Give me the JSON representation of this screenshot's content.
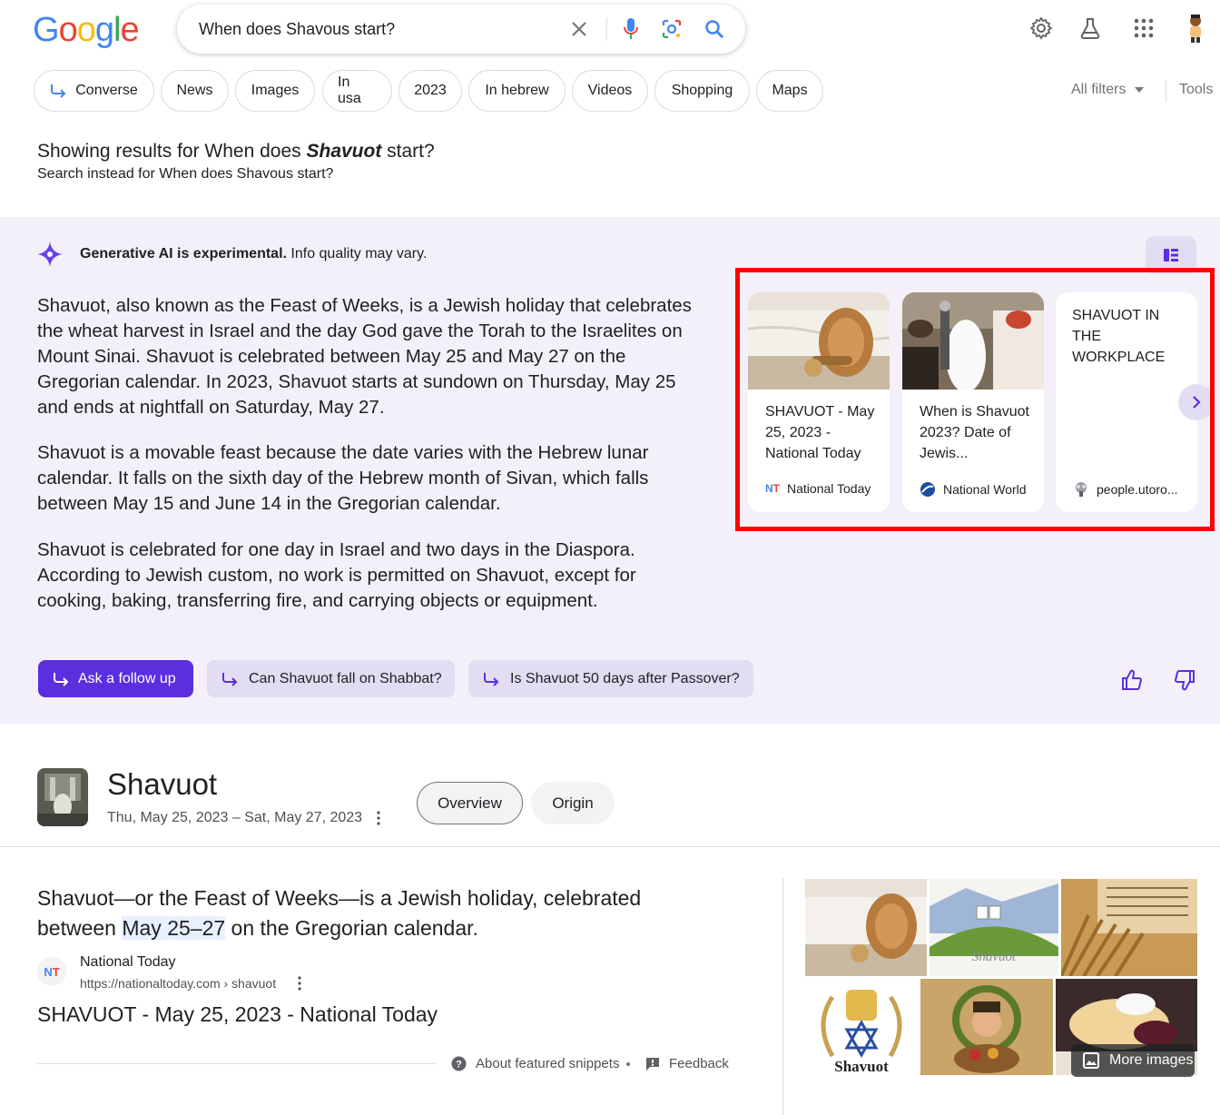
{
  "logo": {
    "letters": [
      "G",
      "o",
      "o",
      "g",
      "l",
      "e"
    ],
    "colors": [
      "#4285f4",
      "#ea4335",
      "#fbbc05",
      "#4285f4",
      "#34a853",
      "#ea4335"
    ]
  },
  "search": {
    "query": "When does Shavous start?"
  },
  "chips": {
    "converse": "Converse",
    "news": "News",
    "images": "Images",
    "in_usa": "In usa",
    "year": "2023",
    "in_hebrew": "In hebrew",
    "videos": "Videos",
    "shopping": "Shopping",
    "maps": "Maps"
  },
  "filters": {
    "all_filters": "All filters",
    "tools": "Tools"
  },
  "correction": {
    "showing_prefix": "Showing results for When does ",
    "showing_bold": "Shavuot",
    "showing_suffix": " start?",
    "instead": "Search instead for When does Shavous start?"
  },
  "ai": {
    "notice_bold": "Generative AI is experimental.",
    "notice_rest": " Info quality may vary.",
    "paragraphs": [
      "Shavuot, also known as the Feast of Weeks, is a Jewish holiday that celebrates the wheat harvest in Israel and the day God gave the Torah to the Israelites on Mount Sinai. Shavuot is celebrated between May 25 and May 27 on the Gregorian calendar. In 2023, Shavuot starts at sundown on Thursday, May 25 and ends at nightfall on Saturday, May 27.",
      "Shavuot is a movable feast because the date varies with the Hebrew lunar calendar. It falls on the sixth day of the Hebrew month of Sivan, which falls between May 15 and June 14 in the Gregorian calendar.",
      "Shavuot is celebrated for one day in Israel and two days in the Diaspora. According to Jewish custom, no work is permitted on Shavuot, except for cooking, baking, transferring fire, and carrying objects or equipment."
    ],
    "cards": [
      {
        "title": "SHAVUOT - May 25, 2023 - National Today",
        "source": "National Today"
      },
      {
        "title": "When is Shavuot 2023? Date of Jewis...",
        "source": "National World"
      },
      {
        "title": "SHAVUOT IN THE WORKPLACE",
        "source": "people.utoro..."
      }
    ],
    "ask_follow_up": "Ask a follow up",
    "suggestions": [
      "Can Shavuot fall on Shabbat?",
      "Is Shavuot 50 days after Passover?"
    ],
    "accent": "#5b2ee0",
    "highlight_color": "#ff0000"
  },
  "knowledge": {
    "title": "Shavuot",
    "dates": "Thu, May 25, 2023 – Sat, May 27, 2023",
    "tabs": [
      "Overview",
      "Origin"
    ]
  },
  "featured": {
    "snippet_before": "Shavuot—or the Feast of Weeks—is a Jewish holiday, celebrated between ",
    "snippet_highlight": "May 25–27",
    "snippet_after": " on the Gregorian calendar.",
    "site_logo": "NT",
    "site_name": "National Today",
    "site_url": "https://nationaltoday.com › shavuot",
    "result_title": "SHAVUOT - May 25, 2023 - National Today",
    "about": "About featured snippets",
    "feedback": "Feedback"
  },
  "gallery": {
    "shavuot_caption": "Shavuot",
    "more_images": "More images"
  }
}
